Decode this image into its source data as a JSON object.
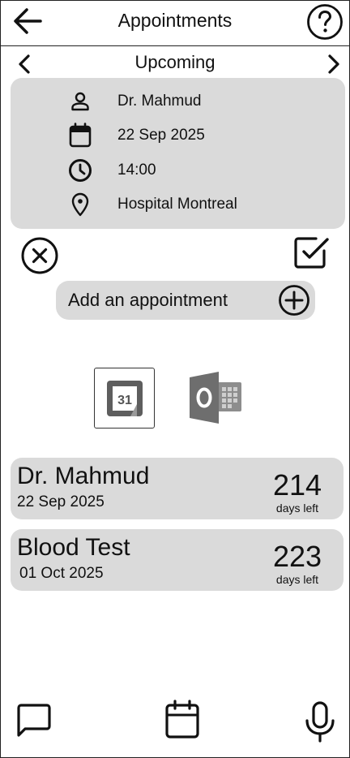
{
  "header": {
    "title": "Appointments"
  },
  "subnav": {
    "label": "Upcoming"
  },
  "details": {
    "doctor": "Dr. Mahmud",
    "date": "22 Sep 2025",
    "time": "14:00",
    "location": "Hospital Montreal"
  },
  "actions": {
    "add_label": "Add an appointment"
  },
  "calendar_integrations": {
    "google_calendar_day": "31"
  },
  "appointments": [
    {
      "name": "Dr. Mahmud",
      "date": "22 Sep 2025",
      "days": "214",
      "days_label": "days left"
    },
    {
      "name": "Blood Test",
      "date": "01 Oct 2025",
      "days": "223",
      "days_label": "days left"
    }
  ],
  "icons": {
    "back": "arrow-left-icon",
    "help": "question-circle-icon",
    "prev": "chevron-left-icon",
    "next": "chevron-right-icon",
    "person": "person-icon",
    "calendar": "calendar-icon",
    "clock": "clock-icon",
    "location": "location-pin-icon",
    "cancel": "x-circle-icon",
    "confirm": "check-square-icon",
    "add": "plus-circle-icon",
    "chat": "chat-icon",
    "mic": "microphone-icon"
  },
  "colors": {
    "card_bg": "#dadada",
    "google_cal_gray": "#666666",
    "outlook_gray": "#6e6e6e"
  }
}
